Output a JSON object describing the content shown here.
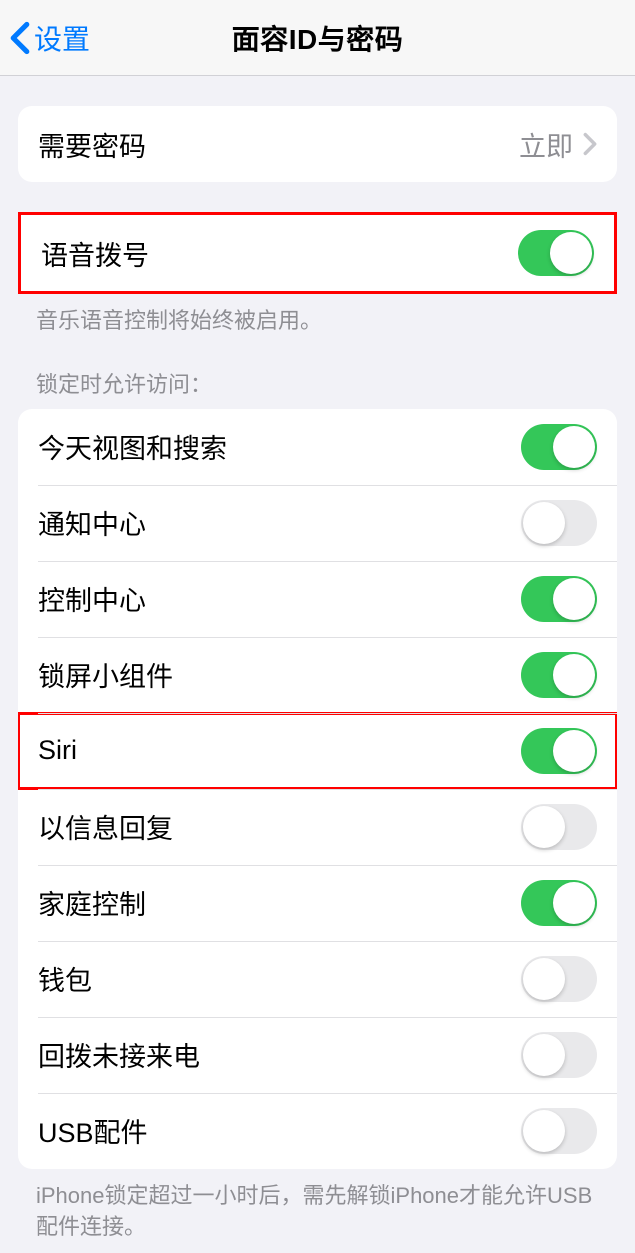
{
  "nav": {
    "back_label": "设置",
    "title": "面容ID与密码"
  },
  "require_passcode": {
    "label": "需要密码",
    "value": "立即"
  },
  "voice_dial": {
    "label": "语音拨号",
    "footer": "音乐语音控制将始终被启用。"
  },
  "lock_access": {
    "header": "锁定时允许访问：",
    "items": [
      {
        "label": "今天视图和搜索",
        "on": true,
        "name": "today-view-search"
      },
      {
        "label": "通知中心",
        "on": false,
        "name": "notification-center"
      },
      {
        "label": "控制中心",
        "on": true,
        "name": "control-center"
      },
      {
        "label": "锁屏小组件",
        "on": true,
        "name": "lock-screen-widgets"
      },
      {
        "label": "Siri",
        "on": true,
        "name": "siri",
        "highlight": true
      },
      {
        "label": "以信息回复",
        "on": false,
        "name": "reply-with-message"
      },
      {
        "label": "家庭控制",
        "on": true,
        "name": "home-control"
      },
      {
        "label": "钱包",
        "on": false,
        "name": "wallet"
      },
      {
        "label": "回拨未接来电",
        "on": false,
        "name": "return-missed-calls"
      },
      {
        "label": "USB配件",
        "on": false,
        "name": "usb-accessories"
      }
    ],
    "footer": "iPhone锁定超过一小时后，需先解锁iPhone才能允许USB配件连接。"
  }
}
